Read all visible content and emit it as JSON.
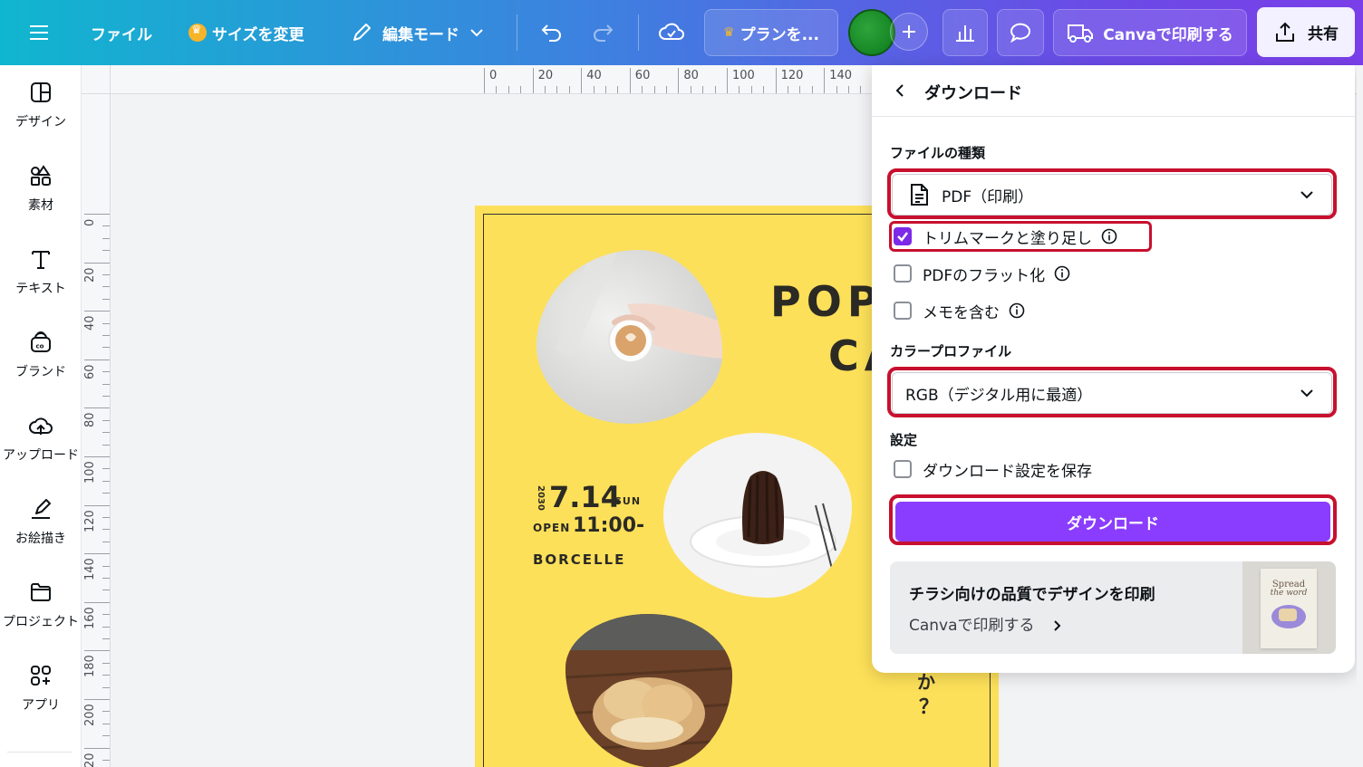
{
  "topbar": {
    "menu_icon": "hamburger-icon",
    "file_label": "ファイル",
    "resize_label": "サイズを変更",
    "edit_mode_label": "編集モード",
    "plan_label": "プランを...",
    "print_label": "Canvaで印刷する",
    "share_label": "共有"
  },
  "sidebar": {
    "items": [
      {
        "label": "デザイン",
        "icon": "design-icon"
      },
      {
        "label": "素材",
        "icon": "elements-icon"
      },
      {
        "label": "テキスト",
        "icon": "text-icon"
      },
      {
        "label": "ブランド",
        "icon": "brand-icon"
      },
      {
        "label": "アップロード",
        "icon": "upload-icon"
      },
      {
        "label": "お絵描き",
        "icon": "draw-icon"
      },
      {
        "label": "プロジェクト",
        "icon": "folder-icon"
      },
      {
        "label": "アプリ",
        "icon": "apps-icon"
      }
    ]
  },
  "ruler": {
    "top": [
      "0",
      "20",
      "40",
      "60",
      "80",
      "100",
      "120",
      "140"
    ],
    "left": [
      "0",
      "20",
      "40",
      "60",
      "80",
      "100",
      "120",
      "140",
      "160",
      "180",
      "200",
      "20"
    ]
  },
  "poster": {
    "title1": "POP",
    "title2": "CA",
    "year": "2030",
    "date": "7.14",
    "weekday": "SUN",
    "open": "OPEN",
    "time": "11:00-",
    "venue": "BORCELLE",
    "side1": "か",
    "side2": "？"
  },
  "panel": {
    "title": "ダウンロード",
    "file_type_label": "ファイルの種類",
    "file_type_value": "PDF（印刷）",
    "options": [
      {
        "label": "トリムマークと塗り足し",
        "checked": true
      },
      {
        "label": "PDFのフラット化",
        "checked": false
      },
      {
        "label": "メモを含む",
        "checked": false
      }
    ],
    "color_profile_label": "カラープロファイル",
    "color_profile_value": "RGB（デジタル用に最適）",
    "settings_label": "設定",
    "save_settings_label": "ダウンロード設定を保存",
    "download_button": "ダウンロード",
    "promo_title": "チラシ向けの品質でデザインを印刷",
    "promo_link": "Canvaで印刷する",
    "promo_thumb_text1": "Spread",
    "promo_thumb_text2": "the word"
  },
  "colors": {
    "accent": "#8b3dff",
    "highlight": "#c7102e",
    "poster_bg": "#fde059"
  }
}
